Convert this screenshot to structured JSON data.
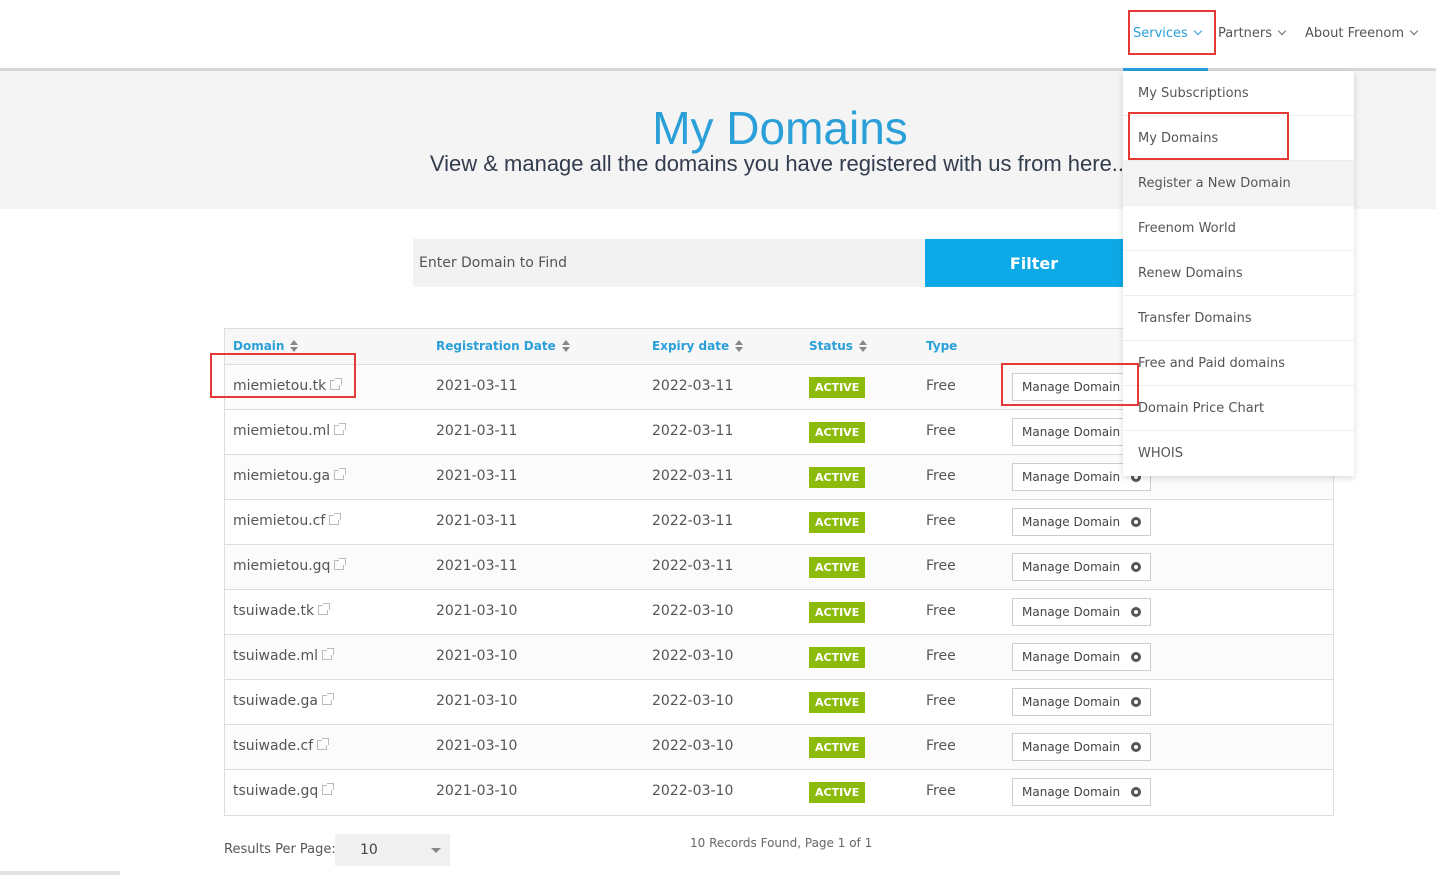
{
  "nav": {
    "services": "Services",
    "partners": "Partners",
    "about": "About Freenom"
  },
  "hero": {
    "title": "My Domains",
    "subtitle": "View & manage all the domains you have registered with us from here..."
  },
  "search": {
    "placeholder": "Enter Domain to Find",
    "filter_label": "Filter"
  },
  "table": {
    "headers": {
      "domain": "Domain",
      "registration_date": "Registration Date",
      "expiry_date": "Expiry date",
      "status": "Status",
      "type": "Type"
    },
    "rows": [
      {
        "domain": "miemietou.tk",
        "reg": "2021-03-11",
        "exp": "2022-03-11",
        "status": "ACTIVE",
        "type": "Free",
        "action": "Manage Domain"
      },
      {
        "domain": "miemietou.ml",
        "reg": "2021-03-11",
        "exp": "2022-03-11",
        "status": "ACTIVE",
        "type": "Free",
        "action": "Manage Domain"
      },
      {
        "domain": "miemietou.ga",
        "reg": "2021-03-11",
        "exp": "2022-03-11",
        "status": "ACTIVE",
        "type": "Free",
        "action": "Manage Domain"
      },
      {
        "domain": "miemietou.cf",
        "reg": "2021-03-11",
        "exp": "2022-03-11",
        "status": "ACTIVE",
        "type": "Free",
        "action": "Manage Domain"
      },
      {
        "domain": "miemietou.gq",
        "reg": "2021-03-11",
        "exp": "2022-03-11",
        "status": "ACTIVE",
        "type": "Free",
        "action": "Manage Domain"
      },
      {
        "domain": "tsuiwade.tk",
        "reg": "2021-03-10",
        "exp": "2022-03-10",
        "status": "ACTIVE",
        "type": "Free",
        "action": "Manage Domain"
      },
      {
        "domain": "tsuiwade.ml",
        "reg": "2021-03-10",
        "exp": "2022-03-10",
        "status": "ACTIVE",
        "type": "Free",
        "action": "Manage Domain"
      },
      {
        "domain": "tsuiwade.ga",
        "reg": "2021-03-10",
        "exp": "2022-03-10",
        "status": "ACTIVE",
        "type": "Free",
        "action": "Manage Domain"
      },
      {
        "domain": "tsuiwade.cf",
        "reg": "2021-03-10",
        "exp": "2022-03-10",
        "status": "ACTIVE",
        "type": "Free",
        "action": "Manage Domain"
      },
      {
        "domain": "tsuiwade.gq",
        "reg": "2021-03-10",
        "exp": "2022-03-10",
        "status": "ACTIVE",
        "type": "Free",
        "action": "Manage Domain"
      }
    ]
  },
  "pagination": {
    "results_per_page_label": "Results Per Page:",
    "results_per_page_value": "10",
    "records_text": "10 Records Found, Page 1 of 1"
  },
  "services_menu": {
    "items": [
      "My Subscriptions",
      "My Domains",
      "Register a New Domain",
      "Freenom World",
      "Renew Domains",
      "Transfer Domains",
      "Free and Paid domains",
      "Domain Price Chart",
      "WHOIS"
    ],
    "hovered_index": 2
  },
  "colors": {
    "accent": "#2a9fd8",
    "filter_button": "#0da9e6",
    "active_badge": "#8cbb0c",
    "annotation": "#e53935"
  }
}
